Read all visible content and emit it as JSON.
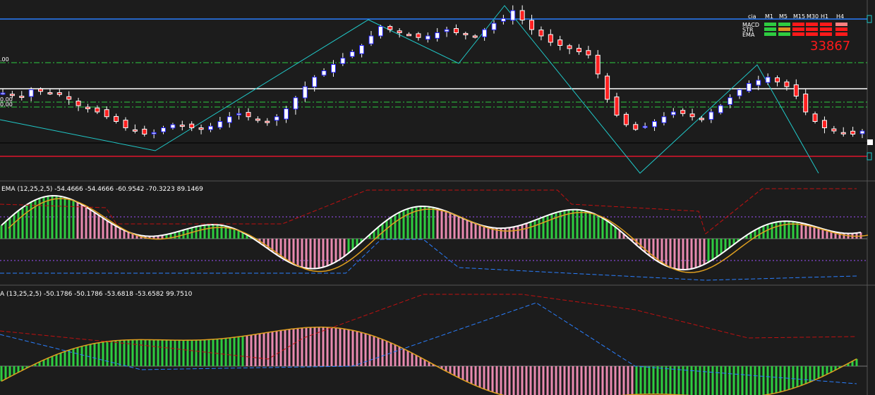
{
  "colors": {
    "background": "#1c1c1c",
    "panel_border": "#555555",
    "bull_candle": "#2020ff",
    "bear_candle": "#ff2020",
    "zigzag": "#20c8c8",
    "blue_level": "#2a7fff",
    "red_level": "#e0142c",
    "white_level": "#ffffff",
    "green_dashdot": "#2ecc40",
    "hist_green": "#2ecc40",
    "hist_pink": "#e88ab0",
    "macd_white": "#ffffff",
    "signal_orange": "#e0a020",
    "band_red": "#c01010",
    "band_blue": "#2a7fff",
    "level_purple": "#a050ff"
  },
  "main_panel": {
    "labels": {
      "top_level": ".00",
      "mid_level_a": "0.00",
      "mid_level_b": "0.00"
    }
  },
  "status_box": {
    "header": [
      "cia",
      "M1",
      "M5",
      "M15",
      "M30",
      "H1",
      "H4"
    ],
    "rows": [
      {
        "name": "MACD",
        "cells": [
          "green",
          "green",
          "red",
          "red",
          "red",
          "salmon"
        ]
      },
      {
        "name": "STR",
        "cells": [
          "green",
          "orange",
          "red",
          "red",
          "red",
          "red"
        ]
      },
      {
        "name": "EMA",
        "cells": [
          "green",
          "green",
          "red",
          "red",
          "red",
          "red"
        ]
      }
    ],
    "value": "33867"
  },
  "panel2": {
    "title": "EMA (12,25,2,5) -54.4666 -54.4666 -60.9542 -70.3223 89.1469"
  },
  "panel3": {
    "title": "A (13,25,2,5) -50.1786 -50.1786 -53.6818 -53.6582 99.7510"
  },
  "chart_data": [
    {
      "type": "candlestick",
      "description": "main price panel",
      "close_path": [
        48,
        47,
        46,
        50,
        49,
        48,
        47,
        44,
        40,
        38,
        36,
        33,
        30,
        26,
        24,
        22,
        23,
        26,
        28,
        27,
        26,
        25,
        27,
        30,
        33,
        35,
        33,
        31,
        30,
        33,
        38,
        45,
        52,
        58,
        62,
        66,
        70,
        74,
        78,
        84,
        90,
        88,
        86,
        85,
        83,
        84,
        86,
        88,
        86,
        85,
        84,
        88,
        92,
        95,
        100,
        94,
        88,
        84,
        80,
        78,
        76,
        74,
        72,
        60,
        44,
        34,
        28,
        25,
        27,
        30,
        33,
        36,
        35,
        33,
        32,
        36,
        40,
        45,
        50,
        54,
        56,
        58,
        55,
        52,
        46,
        36,
        30,
        26,
        24,
        23,
        22,
        24
      ]
    },
    {
      "type": "line",
      "description": "MACD panel (EMA 12,25,2,5) histogram with MACD and signal lines",
      "series": [
        {
          "name": "EMA (12,25,2,5)",
          "values": [
            -54.4666,
            -54.4666,
            -60.9542,
            -70.3223,
            89.1469
          ]
        }
      ]
    },
    {
      "type": "line",
      "description": "second oscillator panel (13,25,2,5) histogram",
      "series": [
        {
          "name": "A (13,25,2,5)",
          "values": [
            -50.1786,
            -50.1786,
            -53.6818,
            -53.6582,
            99.751
          ]
        }
      ]
    }
  ]
}
